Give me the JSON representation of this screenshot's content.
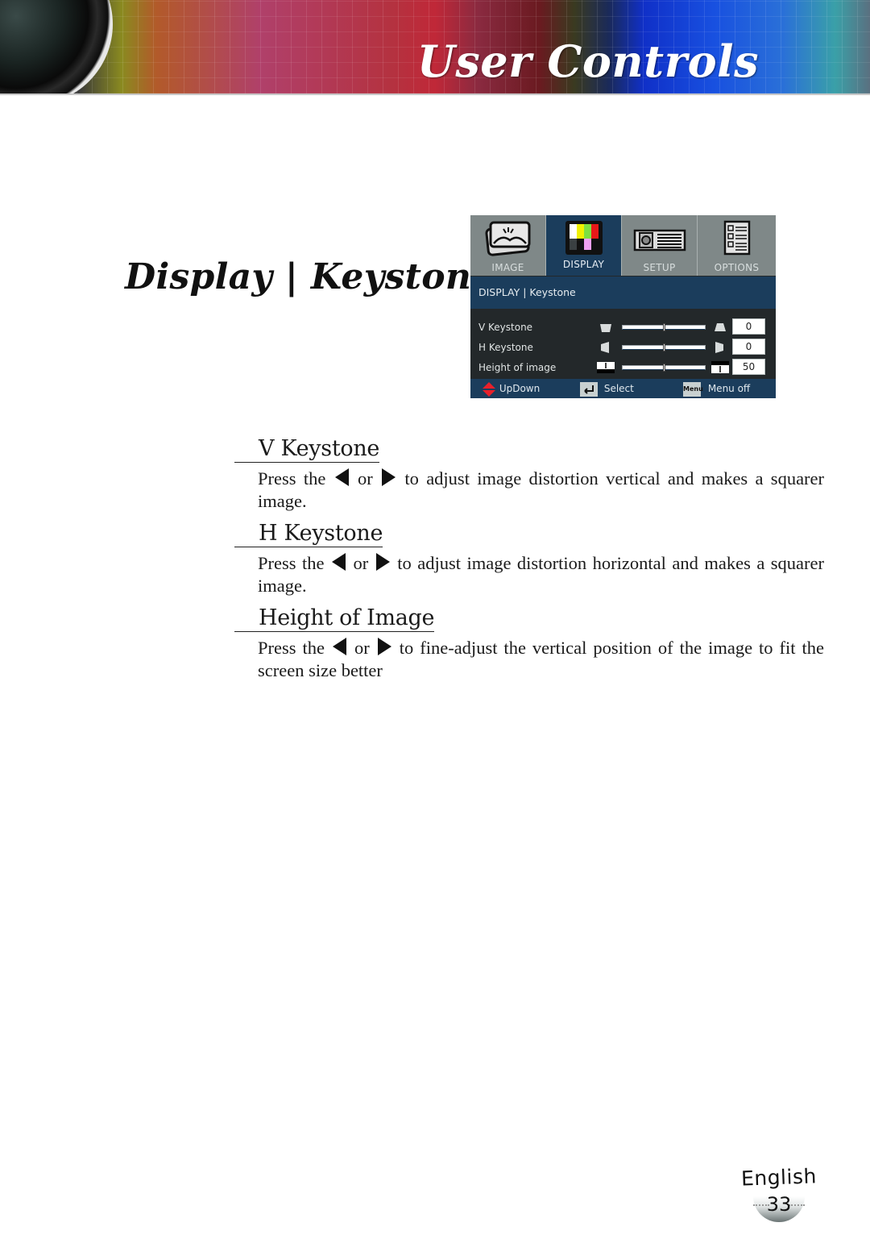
{
  "header": {
    "title": "User Controls"
  },
  "section": {
    "heading": "Display | Keystone"
  },
  "osd_menu": {
    "tabs": [
      {
        "label": "IMAGE",
        "icon": "image-photos-icon",
        "active": false
      },
      {
        "label": "DISPLAY",
        "icon": "color-bars-icon",
        "active": true
      },
      {
        "label": "SETUP",
        "icon": "projector-icon",
        "active": false
      },
      {
        "label": "OPTIONS",
        "icon": "checklist-icon",
        "active": false
      }
    ],
    "breadcrumb": "DISPLAY | Keystone",
    "rows": [
      {
        "label": "V Keystone",
        "value": "0",
        "slider_fraction": 0.5,
        "left_icon": "keystone-v-minus-icon",
        "right_icon": "keystone-v-plus-icon"
      },
      {
        "label": "H Keystone",
        "value": "0",
        "slider_fraction": 0.5,
        "left_icon": "keystone-h-minus-icon",
        "right_icon": "keystone-h-plus-icon"
      },
      {
        "label": "Height of image",
        "value": "50",
        "slider_fraction": 0.5,
        "left_icon": "height-up-icon",
        "right_icon": "height-down-icon"
      }
    ],
    "footer": {
      "updown": "UpDown",
      "select": "Select",
      "menu_key": "Menu",
      "menu_off": "Menu off"
    },
    "colors": {
      "active_tab": "#1b3d5c",
      "inactive_tab": "#7f8888",
      "panel_bg": "#23282a"
    }
  },
  "items": [
    {
      "title": "V Keystone",
      "desc_before": "Press the",
      "desc_or": "or",
      "desc_after": "to adjust image distortion vertical and makes a squarer image."
    },
    {
      "title": "H Keystone",
      "desc_before": "Press the",
      "desc_or": "or",
      "desc_after": "to adjust image distortion horizontal and makes a squarer image."
    },
    {
      "title": "Height of Image",
      "desc_before": "Press the",
      "desc_or": "or",
      "desc_after": "to fine-adjust the vertical position of the image to fit the screen size better"
    }
  ],
  "footer": {
    "language": "English",
    "page_number": "33"
  }
}
